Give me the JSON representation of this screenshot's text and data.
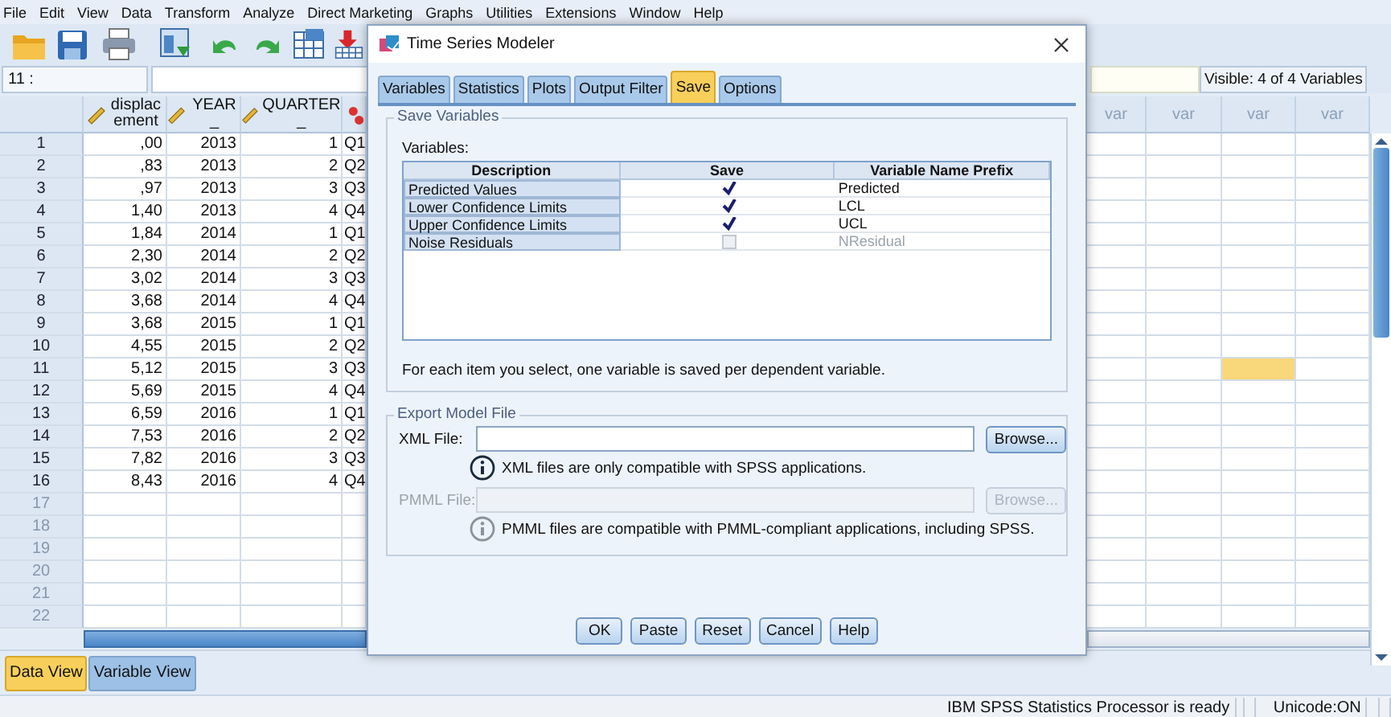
{
  "menu": [
    "File",
    "Edit",
    "View",
    "Data",
    "Transform",
    "Analyze",
    "Direct Marketing",
    "Graphs",
    "Utilities",
    "Extensions",
    "Window",
    "Help"
  ],
  "cell_editor": {
    "case": "11 :",
    "visible": "Visible: 4 of 4 Variables"
  },
  "grid": {
    "columns": [
      {
        "label": "displacement",
        "kind": "scale"
      },
      {
        "label": "YEAR_",
        "kind": "scale"
      },
      {
        "label": "QUARTER_",
        "kind": "scale"
      },
      {
        "kind": "nominal"
      }
    ],
    "var_columns": [
      {
        "label": "var",
        "selected": false
      },
      {
        "label": "var",
        "selected": false
      },
      {
        "label": "var",
        "selected": true
      },
      {
        "label": "var",
        "selected": false
      }
    ],
    "rows": [
      {
        "number": "1",
        "values": [
          ",00",
          "2013",
          "1",
          "Q1"
        ],
        "selected": false
      },
      {
        "number": "2",
        "values": [
          ",83",
          "2013",
          "2",
          "Q2"
        ],
        "selected": false
      },
      {
        "number": "3",
        "values": [
          ",97",
          "2013",
          "3",
          "Q3"
        ],
        "selected": false
      },
      {
        "number": "4",
        "values": [
          "1,40",
          "2013",
          "4",
          "Q4"
        ],
        "selected": false
      },
      {
        "number": "5",
        "values": [
          "1,84",
          "2014",
          "1",
          "Q1"
        ],
        "selected": false
      },
      {
        "number": "6",
        "values": [
          "2,30",
          "2014",
          "2",
          "Q2"
        ],
        "selected": false
      },
      {
        "number": "7",
        "values": [
          "3,02",
          "2014",
          "3",
          "Q3"
        ],
        "selected": false
      },
      {
        "number": "8",
        "values": [
          "3,68",
          "2014",
          "4",
          "Q4"
        ],
        "selected": false
      },
      {
        "number": "9",
        "values": [
          "3,68",
          "2015",
          "1",
          "Q1"
        ],
        "selected": false
      },
      {
        "number": "10",
        "values": [
          "4,55",
          "2015",
          "2",
          "Q2"
        ],
        "selected": false
      },
      {
        "number": "11",
        "values": [
          "5,12",
          "2015",
          "3",
          "Q3"
        ],
        "selected": true
      },
      {
        "number": "12",
        "values": [
          "5,69",
          "2015",
          "4",
          "Q4"
        ],
        "selected": false
      },
      {
        "number": "13",
        "values": [
          "6,59",
          "2016",
          "1",
          "Q1"
        ],
        "selected": false
      },
      {
        "number": "14",
        "values": [
          "7,53",
          "2016",
          "2",
          "Q2"
        ],
        "selected": false
      },
      {
        "number": "15",
        "values": [
          "7,82",
          "2016",
          "3",
          "Q3"
        ],
        "selected": false
      },
      {
        "number": "16",
        "values": [
          "8,43",
          "2016",
          "4",
          "Q4"
        ],
        "selected": false
      },
      {
        "number": "17",
        "selected": false
      },
      {
        "number": "18",
        "selected": false
      },
      {
        "number": "19",
        "selected": false
      },
      {
        "number": "20",
        "selected": false
      },
      {
        "number": "21",
        "selected": false
      },
      {
        "number": "22",
        "selected": false
      }
    ]
  },
  "dialog": {
    "title": "Time Series Modeler",
    "tabs": [
      {
        "label": "Variables",
        "selected": false
      },
      {
        "label": "Statistics",
        "selected": false
      },
      {
        "label": "Plots",
        "selected": false
      },
      {
        "label": "Output Filter",
        "selected": false
      },
      {
        "label": "Save",
        "selected": true
      },
      {
        "label": "Options",
        "selected": false
      }
    ],
    "save_group": {
      "title": "Save Variables",
      "table_label": "Variables:",
      "columns": [
        "Description",
        "Save",
        "Variable Name Prefix"
      ],
      "rows": [
        {
          "description": "Predicted Values",
          "checked": true,
          "prefix": "Predicted",
          "disabled": false
        },
        {
          "description": "Lower Confidence Limits",
          "checked": true,
          "prefix": "LCL",
          "disabled": false
        },
        {
          "description": "Upper Confidence Limits",
          "checked": true,
          "prefix": "UCL",
          "disabled": false
        },
        {
          "description": "Noise Residuals",
          "checked": false,
          "prefix": "NResidual",
          "disabled": true
        }
      ],
      "note": "For each item you select, one variable is saved per dependent variable."
    },
    "export_group": {
      "title": "Export Model File",
      "fields": [
        {
          "label": "XML File:",
          "button": "Browse...",
          "info": "XML files are only compatible with SPSS applications.",
          "disabled": false
        },
        {
          "label": "PMML File:",
          "button": "Browse...",
          "info": "PMML files are compatible with PMML-compliant applications, including SPSS.",
          "disabled": true
        }
      ]
    },
    "buttons": [
      "OK",
      "Paste",
      "Reset",
      "Cancel",
      "Help"
    ]
  },
  "view_tabs": [
    {
      "label": "Data View",
      "selected": true
    },
    {
      "label": "Variable View",
      "selected": false
    }
  ],
  "status": [
    "IBM SPSS Statistics Processor is ready",
    "Unicode:ON"
  ]
}
